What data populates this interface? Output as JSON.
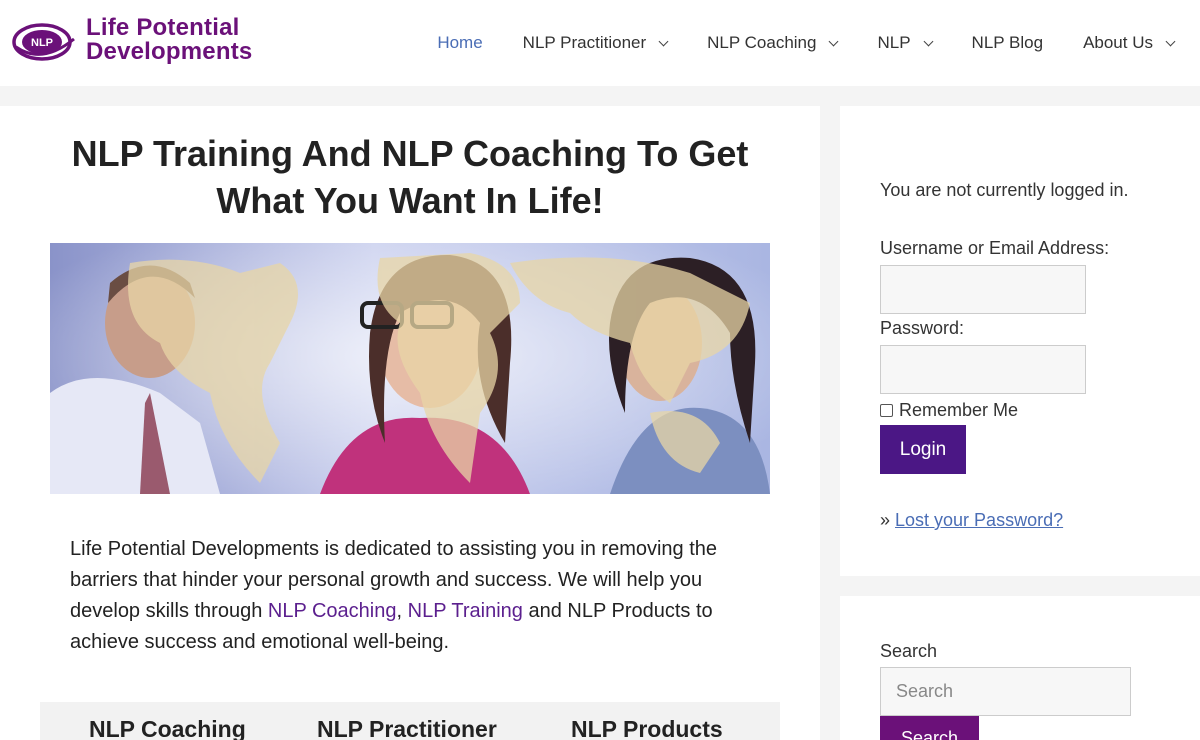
{
  "header": {
    "logo_badge": "NLP",
    "logo_line1": "Life Potential",
    "logo_line2": "Developments",
    "nav": [
      {
        "label": "Home",
        "active": true,
        "dropdown": false
      },
      {
        "label": "NLP Practitioner",
        "active": false,
        "dropdown": true
      },
      {
        "label": "NLP Coaching",
        "active": false,
        "dropdown": true
      },
      {
        "label": "NLP",
        "active": false,
        "dropdown": true
      },
      {
        "label": "NLP Blog",
        "active": false,
        "dropdown": false
      },
      {
        "label": "About Us",
        "active": false,
        "dropdown": true
      }
    ]
  },
  "main": {
    "title_line1": "NLP Training And NLP Coaching To Get",
    "title_line2": "What You Want In Life!",
    "intro": {
      "text1": "Life Potential Developments is dedicated to assisting you in removing the barriers that hinder your personal growth and success. We will help you develop skills through ",
      "link1": "NLP Coaching",
      "sep": ", ",
      "link2": "NLP Training",
      "text2": " and NLP Products to achieve success and emotional well-being."
    },
    "features": [
      "NLP Coaching",
      "NLP Practitioner",
      "NLP Products"
    ]
  },
  "sidebar": {
    "login": {
      "status": "You are not currently logged in.",
      "username_label": "Username or Email Address:",
      "password_label": "Password:",
      "remember_label": "Remember Me",
      "login_button": "Login",
      "lost_prefix": "» ",
      "lost_link": "Lost your Password?"
    },
    "search": {
      "label": "Search",
      "placeholder": "Search",
      "button": "Search"
    }
  },
  "colors": {
    "brand_purple": "#6b1179",
    "button_purple": "#4b1785",
    "link_blue": "#4a6db5",
    "link_purple": "#5b1f8e"
  }
}
